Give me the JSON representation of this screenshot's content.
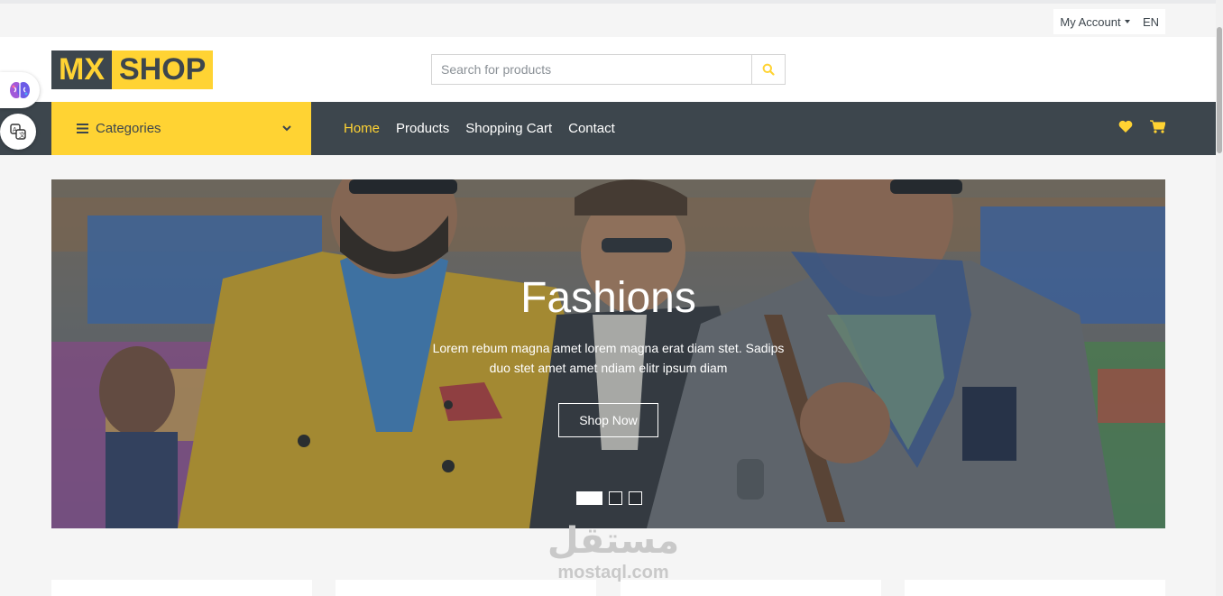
{
  "topbar": {
    "account_label": "My Account",
    "language": "EN"
  },
  "header": {
    "logo": {
      "part1": "MX",
      "part2": "SHOP"
    },
    "search": {
      "placeholder": "Search for products",
      "value": ""
    }
  },
  "nav": {
    "categories_label": "Categories",
    "menu": [
      {
        "label": "Home",
        "active": true
      },
      {
        "label": "Products",
        "active": false
      },
      {
        "label": "Shopping Cart",
        "active": false
      },
      {
        "label": "Contact",
        "active": false
      }
    ]
  },
  "hero": {
    "title": "Fashions",
    "description": "Lorem rebum magna amet lorem magna erat diam stet. Sadips duo stet amet amet ndiam elitr ipsum diam",
    "button_label": "Shop Now",
    "slides": 3,
    "active_slide": 1
  },
  "watermark": {
    "arabic": "مستقل",
    "domain": "mostaql.com"
  },
  "colors": {
    "accent": "#ffd333",
    "dark": "#3d464d",
    "light_bg": "#f5f5f5"
  },
  "icons": [
    "brain-icon",
    "translate-icon",
    "search-icon",
    "bars-icon",
    "chevron-down-icon",
    "heart-icon",
    "cart-icon"
  ]
}
